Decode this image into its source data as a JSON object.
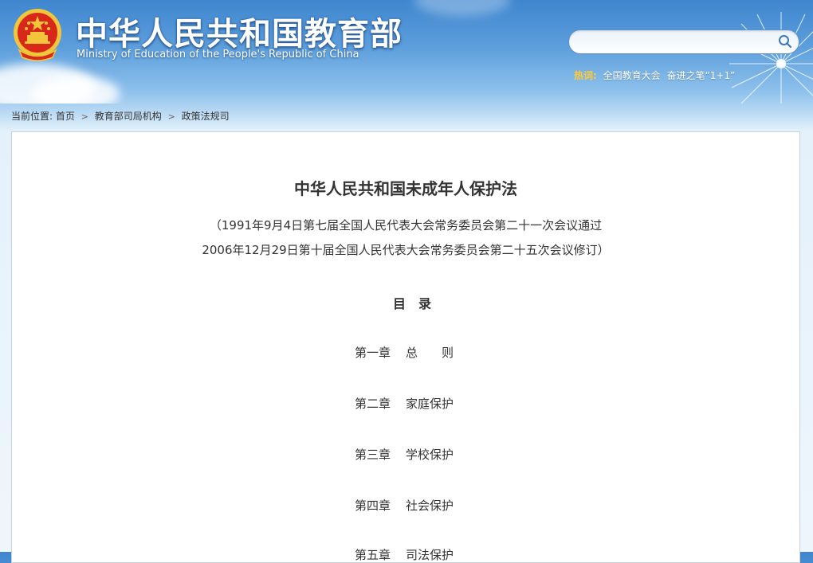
{
  "header": {
    "title_cn": "中华人民共和国教育部",
    "title_en": "Ministry of Education of the People's Republic of China",
    "emblem_icon": "national-emblem-icon",
    "colors": {
      "sky": "#3f86cf",
      "hot_label": "#ffcc33",
      "emblem_red": "#d8281a",
      "emblem_gold": "#f3c53a"
    }
  },
  "search": {
    "placeholder": "",
    "value": "",
    "icon": "search-icon"
  },
  "hot": {
    "label": "热词:",
    "links": [
      "全国教育大会",
      "奋进之笔“1+1”"
    ]
  },
  "breadcrumb": {
    "prefix": "当前位置:",
    "items": [
      "首页",
      "教育部司局机构",
      "政策法规司"
    ]
  },
  "article": {
    "title": "中华人民共和国未成年人保护法",
    "sublines": [
      "（1991年9月4日第七届全国人民代表大会常务委员会第二十一次会议通过",
      "2006年12月29日第十届全国人民代表大会常务委员会第二十五次会议修订）"
    ],
    "toc_heading": "目录",
    "chapters": [
      {
        "num": "第一章",
        "name": "总　　则"
      },
      {
        "num": "第二章",
        "name": "家庭保护"
      },
      {
        "num": "第三章",
        "name": "学校保护"
      },
      {
        "num": "第四章",
        "name": "社会保护"
      },
      {
        "num": "第五章",
        "name": "司法保护"
      }
    ]
  }
}
